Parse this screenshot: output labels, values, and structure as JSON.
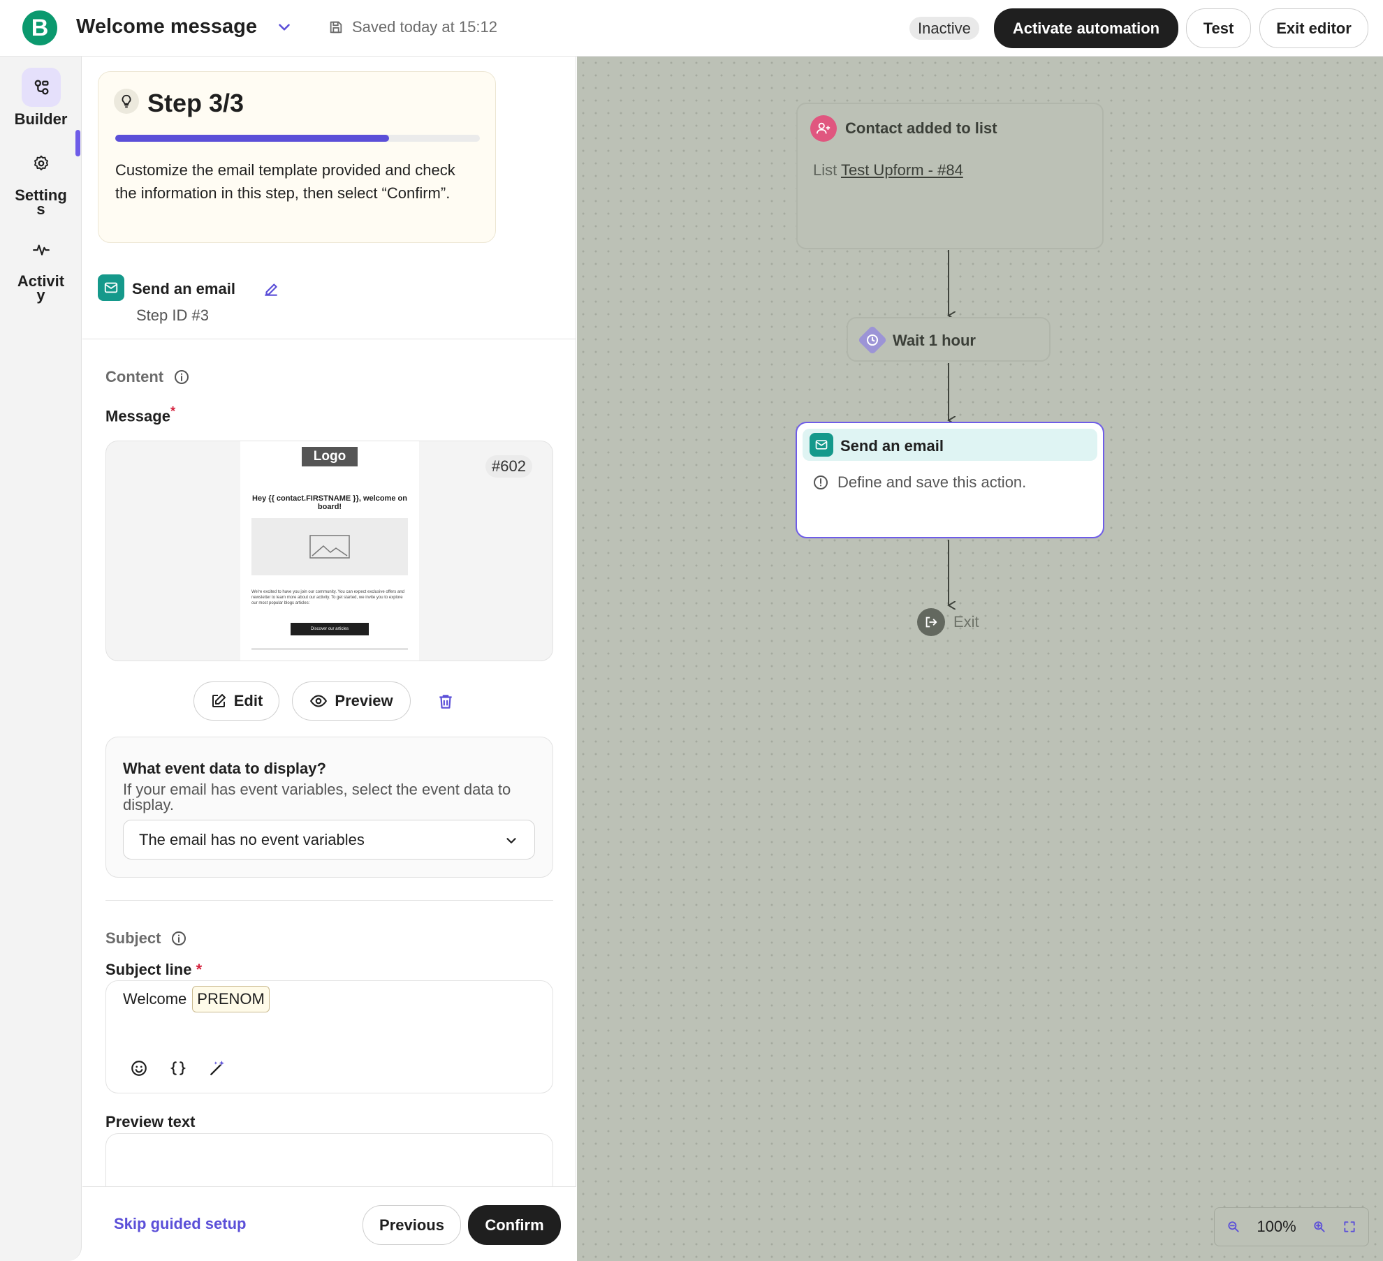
{
  "header": {
    "logo_letter": "B",
    "title": "Welcome message",
    "saved_status": "Saved today at 15:12",
    "status_badge": "Inactive",
    "activate_label": "Activate automation",
    "test_label": "Test",
    "exit_label": "Exit editor"
  },
  "rail": {
    "items": [
      {
        "label": "Builder",
        "icon": "builder-icon",
        "active": true
      },
      {
        "label_line1": "Setting",
        "label_line2": "s",
        "icon": "gear-icon"
      },
      {
        "label_line1": "Activit",
        "label_line2": "y",
        "icon": "activity-icon"
      }
    ]
  },
  "guide": {
    "step_title": "Step 3/3",
    "progress": 0.75,
    "description": "Customize the email template provided and check the information in this step, then select “Confirm”."
  },
  "action": {
    "title": "Send an email",
    "step_id": "Step ID #3"
  },
  "content": {
    "section_label": "Content",
    "message_label": "Message",
    "required_mark": "*",
    "template": {
      "logo": "Logo",
      "heading": "Hey {{ contact.FIRSTNAME }}, welcome on board!",
      "body": "We're excited to have you join our community. You can expect exclusive offers and newsletter to learn more about our activity. To get started, we invite you to explore our most popular blogs articles:",
      "cta": "Discover our articles",
      "id": "#602"
    },
    "edit_label": "Edit",
    "preview_label": "Preview"
  },
  "event": {
    "title": "What event data to display?",
    "help": "If your email has event variables, select the event data to display.",
    "selected": "The email has no event variables"
  },
  "subject": {
    "section_label": "Subject",
    "line_label": "Subject line",
    "required_mark": "*",
    "text": "Welcome",
    "tag": "PRENOM",
    "preview_text_label": "Preview text"
  },
  "footer": {
    "skip_label": "Skip guided setup",
    "previous_label": "Previous",
    "confirm_label": "Confirm"
  },
  "workflow": {
    "trigger_title": "Contact added to list",
    "trigger_sub_prefix": "List",
    "trigger_sub_link": "Test Upform - #84",
    "wait_title": "Wait 1 hour",
    "email_title": "Send an email",
    "email_warning": "Define and save this action.",
    "exit_label": "Exit",
    "zoom_level": "100%"
  },
  "colors": {
    "accent": "#5b4fd8",
    "brand": "#0b996e",
    "teal": "#15998b",
    "canvas": "#bcc1b6",
    "dark": "#1f1f1f"
  }
}
